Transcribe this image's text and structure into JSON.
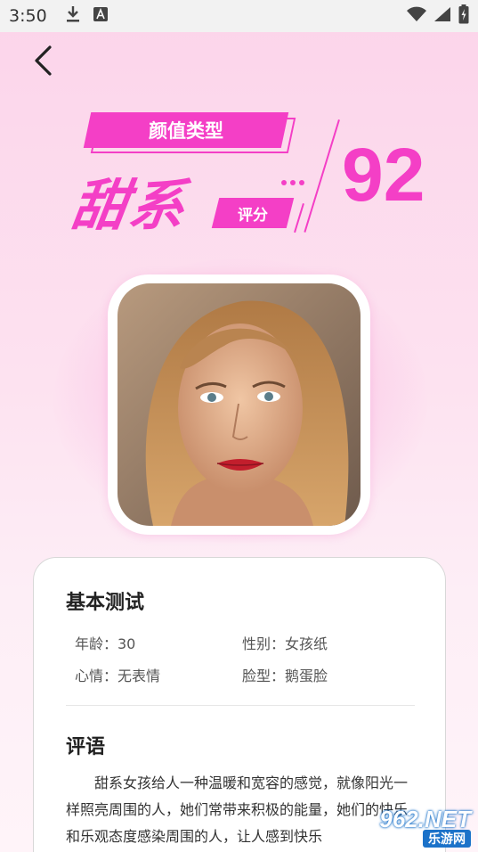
{
  "status_bar": {
    "time": "3:50",
    "icons": [
      "download-icon",
      "font-a-icon",
      "wifi-icon",
      "signal-icon",
      "battery-icon"
    ]
  },
  "header": {
    "type_label": "颜值类型",
    "type_value": "甜系",
    "score_label": "评分",
    "score_value": "92"
  },
  "basic_test": {
    "title": "基本测试",
    "age": "年龄：30",
    "gender": "性别：女孩纸",
    "mood": "心情：无表情",
    "face_shape": "脸型：鹅蛋脸"
  },
  "comment_section": {
    "title": "评语",
    "text": "甜系女孩给人一种温暖和宽容的感觉，就像阳光一样照亮周围的人，她们常带来积极的能量，她们的快乐和乐观态度感染周围的人，让人感到快乐"
  },
  "watermark": {
    "line1": "962.NET",
    "line2": "乐游网"
  },
  "colors": {
    "accent": "#f43fc6",
    "background_top": "#fcd4ea",
    "background_bottom": "#fff4f9"
  }
}
